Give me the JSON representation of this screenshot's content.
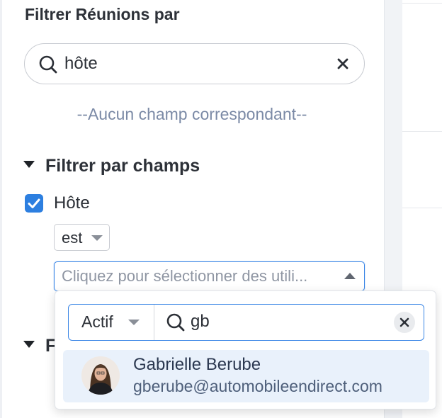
{
  "panel": {
    "title": "Filtrer Réunions par",
    "search_value": "hôte",
    "no_match_text": "--Aucun champ correspondant--"
  },
  "section": {
    "title": "Filtrer par champs",
    "field": {
      "label": "Hôte",
      "checked": true,
      "operator": "est",
      "user_select_placeholder": "Cliquez pour sélectionner des utili..."
    }
  },
  "behind_section": {
    "title": "F"
  },
  "dropdown": {
    "filter_value": "Actif",
    "search_query": "gb",
    "results": [
      {
        "name": "Gabrielle Berube",
        "email": "gberube@automobileendirect.com"
      }
    ]
  },
  "colors": {
    "accent": "#2d7fe0",
    "focus_border": "#3a86e6",
    "highlight_row": "#e9f1fb",
    "muted_text": "#7b8aa6"
  }
}
